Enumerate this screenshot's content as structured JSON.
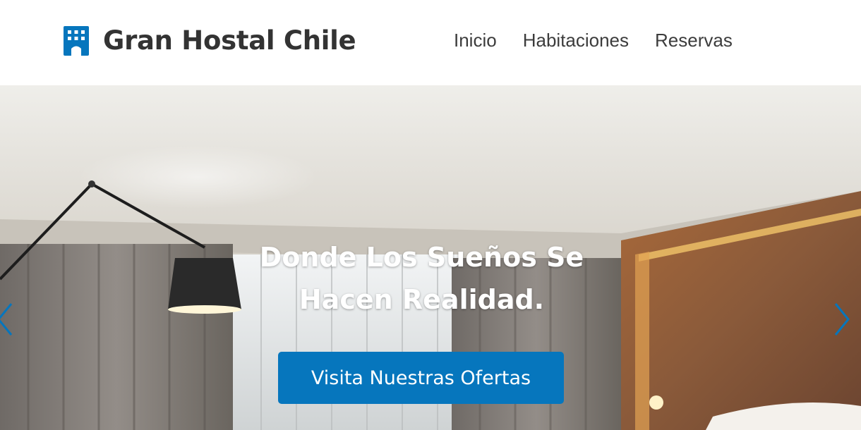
{
  "brand": {
    "name": "Gran Hostal Chile",
    "icon": "hotel-building-icon",
    "icon_color": "#0676bd"
  },
  "nav": {
    "items": [
      {
        "label": "Inicio"
      },
      {
        "label": "Habitaciones"
      },
      {
        "label": "Reservas"
      }
    ]
  },
  "hero": {
    "title": "Donde Los Sueños Se Hacen Realidad.",
    "cta_label": "Visita Nuestras Ofertas",
    "prev_icon": "chevron-left-icon",
    "next_icon": "chevron-right-icon",
    "accent": "#0676bd"
  }
}
